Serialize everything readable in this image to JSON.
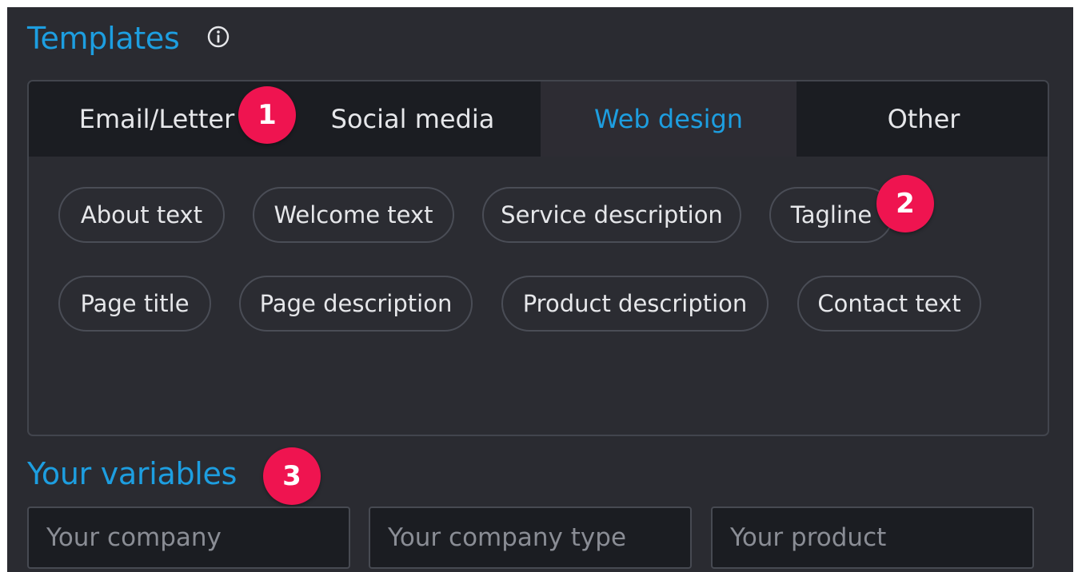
{
  "templates": {
    "title": "Templates",
    "tabs": [
      {
        "label": "Email/Letter"
      },
      {
        "label": "Social media"
      },
      {
        "label": "Web design"
      },
      {
        "label": "Other"
      }
    ],
    "active_tab": "Web design",
    "chips": [
      "About text",
      "Welcome text",
      "Service description",
      "Tagline",
      "Page title",
      "Page description",
      "Product description",
      "Contact text"
    ]
  },
  "variables": {
    "title": "Your variables",
    "fields": [
      {
        "placeholder": "Your company"
      },
      {
        "placeholder": "Your company type"
      },
      {
        "placeholder": "Your product"
      }
    ]
  },
  "badges": [
    "1",
    "2",
    "3"
  ],
  "colors": {
    "accent": "#1d9ee0",
    "badge": "#ef1450",
    "panel_bg": "#2a2b31",
    "tab_bg": "#1b1d22"
  },
  "icons": {
    "info": "info-circle-icon"
  }
}
